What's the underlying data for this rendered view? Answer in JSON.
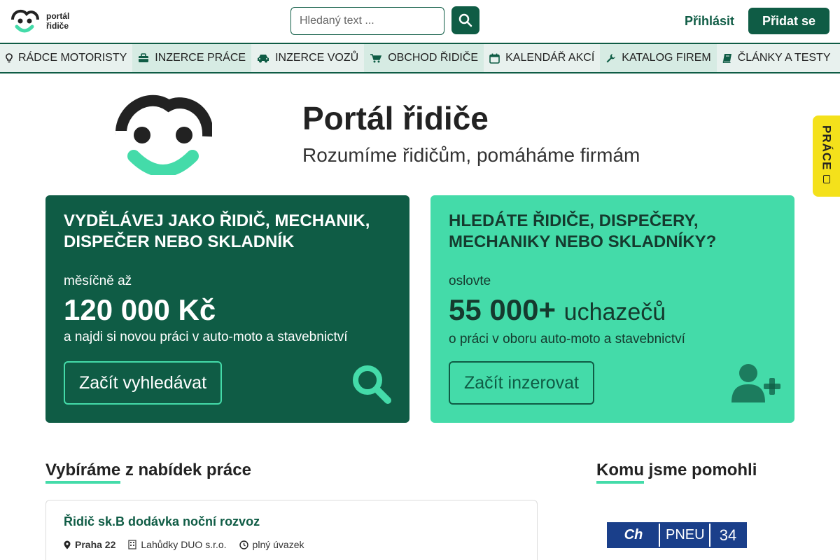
{
  "header": {
    "logo_text_line1": "portál",
    "logo_text_line2": "řidiče",
    "search_placeholder": "Hledaný text ...",
    "login_label": "Přihlásit",
    "join_label": "Přidat se"
  },
  "nav": {
    "items": [
      {
        "label": "RÁDCE MOTORISTY",
        "icon": "lightbulb-icon"
      },
      {
        "label": "INZERCE PRÁCE",
        "icon": "briefcase-icon"
      },
      {
        "label": "INZERCE VOZŮ",
        "icon": "car-icon"
      },
      {
        "label": "OBCHOD ŘIDIČE",
        "icon": "cart-icon"
      },
      {
        "label": "KALENDÁŘ AKCÍ",
        "icon": "calendar-icon"
      },
      {
        "label": "KATALOG FIREM",
        "icon": "wrench-icon"
      },
      {
        "label": "ČLÁNKY A TESTY",
        "icon": "book-icon"
      }
    ]
  },
  "hero": {
    "title": "Portál řidiče",
    "subtitle": "Rozumíme řidičům, pomáháme firmám"
  },
  "side_tab": {
    "label": "PRÁCE"
  },
  "cards": {
    "left": {
      "title": "VYDĚLÁVEJ JAKO ŘIDIČ, MECHANIK, DISPEČER NEBO SKLADNÍK",
      "lead": "měsíčně až",
      "big": "120 000 Kč",
      "desc": "a najdi si novou práci v auto-moto a stavebnictví",
      "button": "Začít vyhledávat"
    },
    "right": {
      "title": "HLEDÁTE ŘIDIČE, DISPEČERY, MECHANIKY NEBO SKLADNÍKY?",
      "lead": "oslovte",
      "big": "55 000+",
      "big_unit": "uchazečů",
      "desc": "o práci v oboru auto-moto a stavebnictví",
      "button": "Začít inzerovat"
    }
  },
  "jobs_section": {
    "heading_highlight": "Vybíráme",
    "heading_rest": " z nabídek práce",
    "job": {
      "title": "Řidič sk.B dodávka noční rozvoz",
      "location": "Praha 22",
      "company": "Lahůdky DUO s.r.o.",
      "type": "plný úvazek"
    }
  },
  "helped_section": {
    "heading_highlight": "Komu",
    "heading_rest": " jsme pomohli",
    "partner": {
      "a": "Ch",
      "b": "PNEU",
      "c": "34"
    }
  },
  "colors": {
    "brand_dark": "#0f5c45",
    "brand_light": "#44dba9",
    "side_tab": "#f4e11b"
  }
}
